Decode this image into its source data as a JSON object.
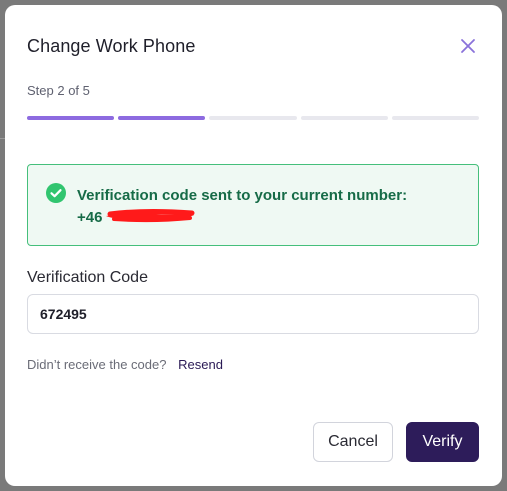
{
  "modal": {
    "title": "Change Work Phone",
    "step_text": "Step 2 of 5",
    "progress": {
      "total_steps": 5,
      "completed_steps": 2,
      "active_color": "#8d6be0",
      "inactive_color": "#e8e8ee"
    }
  },
  "alert": {
    "message": "Verification code sent to your current number:",
    "phone_prefix": "+46",
    "icon": "check-circle-icon",
    "text_color": "#166b47",
    "border_color": "#45bf7b"
  },
  "form": {
    "label": "Verification Code",
    "value": "672495"
  },
  "resend": {
    "prompt": "Didn’t receive the code?",
    "link_label": "Resend"
  },
  "buttons": {
    "cancel_label": "Cancel",
    "verify_label": "Verify",
    "verify_color": "#2d1c5a"
  },
  "icons": {
    "close": "close-icon"
  }
}
